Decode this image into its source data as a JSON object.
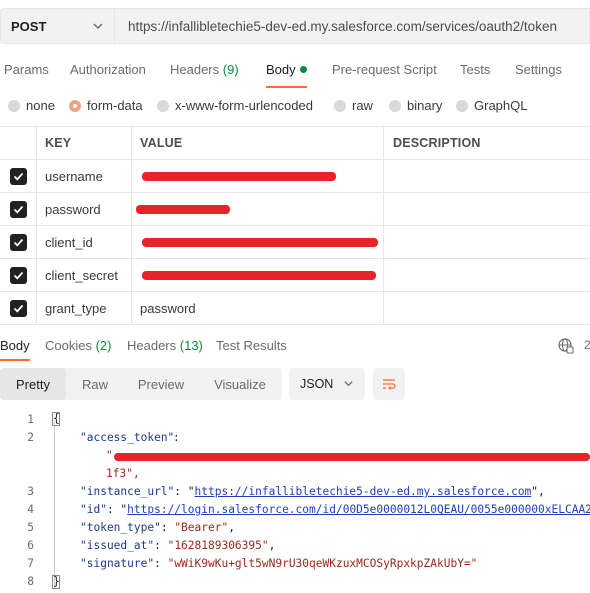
{
  "request": {
    "method": "POST",
    "url": "https://infallibletechie5-dev-ed.my.salesforce.com/services/oauth2/token"
  },
  "request_tabs": [
    {
      "label": "Params",
      "count": ""
    },
    {
      "label": "Authorization",
      "count": ""
    },
    {
      "label": "Headers",
      "count": "(9)"
    },
    {
      "label": "Body",
      "count": ""
    },
    {
      "label": "Pre-request Script",
      "count": ""
    },
    {
      "label": "Tests",
      "count": ""
    },
    {
      "label": "Settings",
      "count": ""
    }
  ],
  "body_types": [
    "none",
    "form-data",
    "x-www-form-urlencoded",
    "raw",
    "binary",
    "GraphQL"
  ],
  "selected_body_type": "form-data",
  "table": {
    "headers": [
      "KEY",
      "VALUE",
      "DESCRIPTION"
    ],
    "rows": [
      {
        "key": "username",
        "value": "",
        "redacted": true
      },
      {
        "key": "password",
        "value": "",
        "redacted": true
      },
      {
        "key": "client_id",
        "value": "",
        "redacted": true
      },
      {
        "key": "client_secret",
        "value": "",
        "redacted": true
      },
      {
        "key": "grant_type",
        "value": "password",
        "redacted": false
      }
    ]
  },
  "response_tabs": [
    {
      "label": "Body",
      "count": ""
    },
    {
      "label": "Cookies",
      "count": "(2)"
    },
    {
      "label": "Headers",
      "count": "(13)"
    },
    {
      "label": "Test Results",
      "count": ""
    }
  ],
  "response_toolbar": {
    "views": [
      "Pretty",
      "Raw",
      "Preview",
      "Visualize"
    ],
    "format": "JSON",
    "truncated_right": "2"
  },
  "response_body": {
    "line_numbers": [
      "1",
      "2",
      "3",
      "4",
      "5",
      "6",
      "7",
      "8"
    ],
    "open_brace": "{",
    "close_brace": "}",
    "access_token_key": "\"access_token\"",
    "access_token_open": "\"",
    "access_token_tail": "1f3\",",
    "instance_url_key": "\"instance_url\"",
    "instance_url_value": "https://infallibletechie5-dev-ed.my.salesforce.com",
    "id_key": "\"id\"",
    "id_value": "https://login.salesforce.com/id/00D5e0000012L0QEAU/0055e000000xELCAA2",
    "token_type_key": "\"token_type\"",
    "token_type_value": "\"Bearer\"",
    "issued_at_key": "\"issued_at\"",
    "issued_at_value": "\"1628189306395\"",
    "signature_key": "\"signature\"",
    "signature_value": "\"wWiK9wKu+glt5wN9rU30qeWKzuxMCOSyRpxkpZAkUbY=\""
  },
  "colors": {
    "accent": "#ff6c37",
    "count_green": "#0f8a3d",
    "redaction": "#e8232a"
  }
}
